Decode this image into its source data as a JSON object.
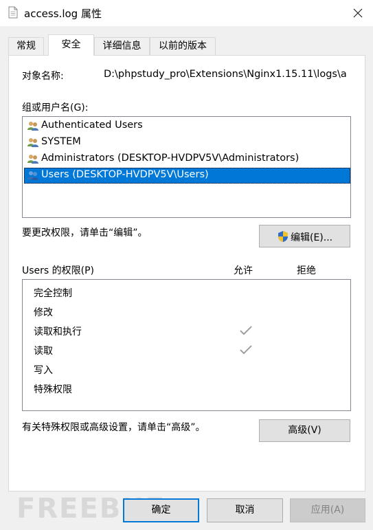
{
  "window": {
    "title": "access.log 属性",
    "close_icon": "close-icon"
  },
  "tabs": [
    {
      "label": "常规",
      "active": false
    },
    {
      "label": "安全",
      "active": true
    },
    {
      "label": "详细信息",
      "active": false
    },
    {
      "label": "以前的版本",
      "active": false
    }
  ],
  "object": {
    "label": "对象名称:",
    "value": "D:\\phpstudy_pro\\Extensions\\Nginx1.15.11\\logs\\a"
  },
  "groups": {
    "label": "组或用户名(G):",
    "items": [
      {
        "name": "Authenticated Users",
        "icon": "users-group-icon",
        "selected": false
      },
      {
        "name": "SYSTEM",
        "icon": "users-group-icon",
        "selected": false
      },
      {
        "name": "Administrators (DESKTOP-HVDPV5V\\Administrators)",
        "icon": "users-group-icon",
        "selected": false
      },
      {
        "name": "Users (DESKTOP-HVDPV5V\\Users)",
        "icon": "users-group-icon",
        "selected": true
      }
    ]
  },
  "edit": {
    "hint": "要更改权限，请单击“编辑”。",
    "button_label": "编辑(E)...",
    "shield_icon": "uac-shield-icon"
  },
  "permissions": {
    "label": "Users 的权限(P)",
    "allow_header": "允许",
    "deny_header": "拒绝",
    "rows": [
      {
        "name": "完全控制",
        "allow": false,
        "deny": false
      },
      {
        "name": "修改",
        "allow": false,
        "deny": false
      },
      {
        "name": "读取和执行",
        "allow": true,
        "deny": false
      },
      {
        "name": "读取",
        "allow": true,
        "deny": false
      },
      {
        "name": "写入",
        "allow": false,
        "deny": false
      },
      {
        "name": "特殊权限",
        "allow": false,
        "deny": false
      }
    ]
  },
  "advanced": {
    "hint": "有关特殊权限或高级设置，请单击“高级”。",
    "button_label": "高级(V)"
  },
  "footer": {
    "ok_label": "确定",
    "cancel_label": "取消",
    "apply_label": "应用(A)",
    "apply_enabled": false
  },
  "watermark": "FREEBUF"
}
